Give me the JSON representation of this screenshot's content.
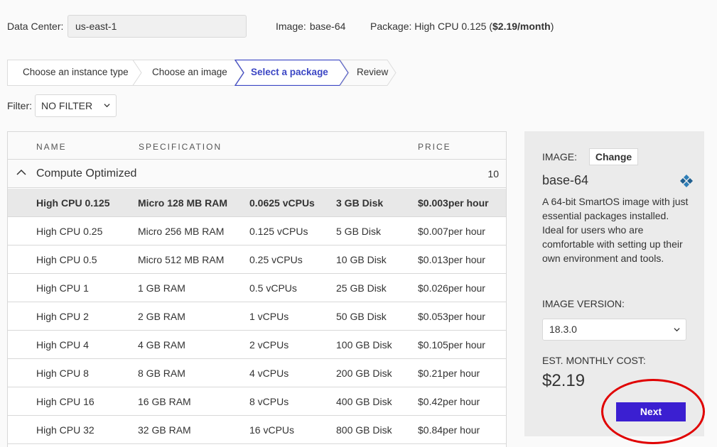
{
  "header": {
    "data_center_label": "Data Center:",
    "data_center_value": "us-east-1",
    "image_label": "Image:",
    "image_value": "base-64",
    "package_label": "Package:",
    "package_value": "High CPU 0.125",
    "package_price_open": "(",
    "package_price": "$2.19/month",
    "package_price_close": ")"
  },
  "steps": [
    {
      "label": "Choose an instance type",
      "active": false
    },
    {
      "label": "Choose an image",
      "active": false
    },
    {
      "label": "Select a package",
      "active": true
    },
    {
      "label": "Review",
      "active": false
    }
  ],
  "filter": {
    "label": "Filter:",
    "selected": "NO FILTER"
  },
  "table": {
    "headers": [
      "NAME",
      "SPECIFICATION",
      "PRICE"
    ],
    "group": {
      "title": "Compute Optimized",
      "count": "10"
    },
    "rows": [
      {
        "name": "High CPU 0.125",
        "ram": "Micro 128 MB RAM",
        "vcpu": "0.0625 vCPUs",
        "disk": "3 GB Disk",
        "price": "$0.003",
        "unit": "per hour",
        "selected": true
      },
      {
        "name": "High CPU 0.25",
        "ram": "Micro 256 MB RAM",
        "vcpu": "0.125 vCPUs",
        "disk": "5 GB Disk",
        "price": "$0.007",
        "unit": "per hour",
        "selected": false
      },
      {
        "name": "High CPU 0.5",
        "ram": "Micro 512 MB RAM",
        "vcpu": "0.25 vCPUs",
        "disk": "10 GB Disk",
        "price": "$0.013",
        "unit": "per hour",
        "selected": false
      },
      {
        "name": "High CPU 1",
        "ram": "1 GB RAM",
        "vcpu": "0.5 vCPUs",
        "disk": "25 GB Disk",
        "price": "$0.026",
        "unit": "per hour",
        "selected": false
      },
      {
        "name": "High CPU 2",
        "ram": "2 GB RAM",
        "vcpu": "1 vCPUs",
        "disk": "50 GB Disk",
        "price": "$0.053",
        "unit": "per hour",
        "selected": false
      },
      {
        "name": "High CPU 4",
        "ram": "4 GB RAM",
        "vcpu": "2 vCPUs",
        "disk": "100 GB Disk",
        "price": "$0.105",
        "unit": "per hour",
        "selected": false
      },
      {
        "name": "High CPU 8",
        "ram": "8 GB RAM",
        "vcpu": "4 vCPUs",
        "disk": "200 GB Disk",
        "price": "$0.21",
        "unit": "per hour",
        "selected": false
      },
      {
        "name": "High CPU 16",
        "ram": "16 GB RAM",
        "vcpu": "8 vCPUs",
        "disk": "400 GB Disk",
        "price": "$0.42",
        "unit": "per hour",
        "selected": false
      },
      {
        "name": "High CPU 32",
        "ram": "32 GB RAM",
        "vcpu": "16 vCPUs",
        "disk": "800 GB Disk",
        "price": "$0.84",
        "unit": "per hour",
        "selected": false
      }
    ]
  },
  "sidebar": {
    "image_label": "IMAGE:",
    "change_label": "Change",
    "image_name": "base-64",
    "image_logo_icon": "smartos-logo-icon",
    "description": "A 64-bit SmartOS image with just essential packages installed. Ideal for users who are comfortable with setting up their own environment and tools.",
    "version_label": "IMAGE VERSION:",
    "version_value": "18.3.0",
    "cost_label": "EST. MONTHLY COST:",
    "cost_value": "$2.19",
    "next_label": "Next"
  },
  "colors": {
    "accent": "#3b1fd1",
    "active_step": "#3b46c4",
    "highlight": "#e00000"
  }
}
